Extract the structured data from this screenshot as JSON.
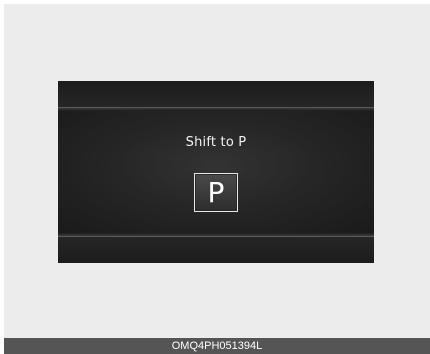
{
  "display": {
    "message": "Shift to P",
    "gear_indicator": "P"
  },
  "caption": {
    "code": "OMQ4PH051394L"
  }
}
